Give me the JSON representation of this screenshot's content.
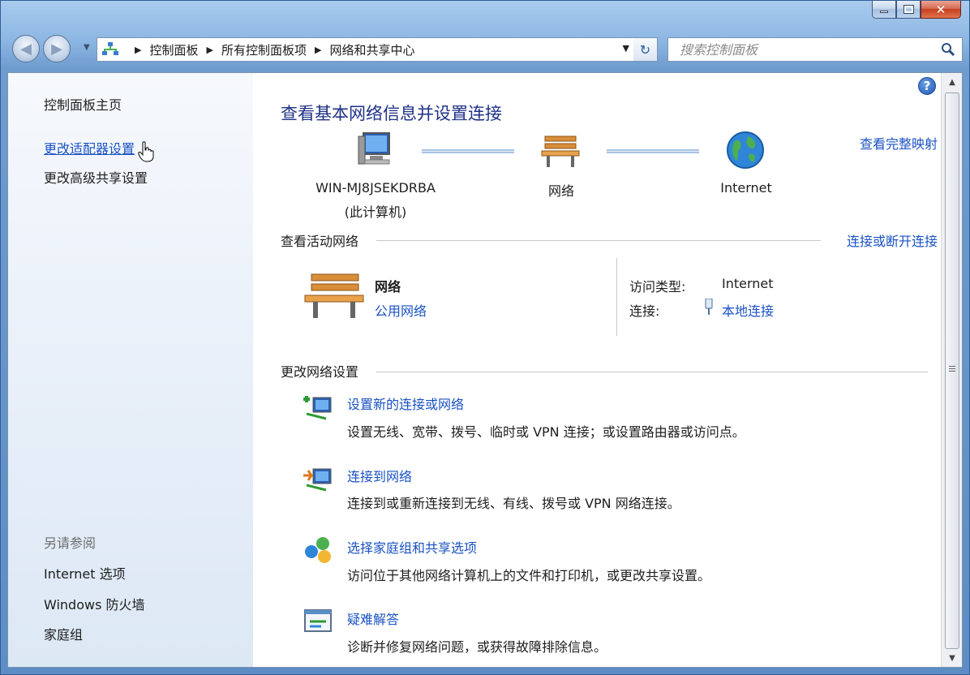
{
  "breadcrumb": [
    "控制面板",
    "所有控制面板项",
    "网络和共享中心"
  ],
  "search": {
    "placeholder": "搜索控制面板"
  },
  "left_pane": {
    "home": "控制面板主页",
    "links": [
      "更改适配器设置",
      "更改高级共享设置"
    ],
    "see_also_title": "另请参阅",
    "see_also": [
      "Internet 选项",
      "Windows 防火墙",
      "家庭组"
    ]
  },
  "main": {
    "title": "查看基本网络信息并设置连接",
    "map_link": "查看完整映射",
    "nodes": {
      "computer": "WIN-MJ8JSEKDRBA",
      "computer_sub": "(此计算机)",
      "network": "网络",
      "internet": "Internet"
    },
    "active_section": {
      "title": "查看活动网络",
      "right_link": "连接或断开连接",
      "network_name": "网络",
      "network_type": "公用网络",
      "access_type_label": "访问类型:",
      "access_type_value": "Internet",
      "connection_label": "连接:",
      "connection_value": "本地连接"
    },
    "change_section": {
      "title": "更改网络设置",
      "tasks": [
        {
          "title": "设置新的连接或网络",
          "desc": "设置无线、宽带、拨号、临时或 VPN 连接；或设置路由器或访问点。"
        },
        {
          "title": "连接到网络",
          "desc": "连接到或重新连接到无线、有线、拨号或 VPN 网络连接。"
        },
        {
          "title": "选择家庭组和共享选项",
          "desc": "访问位于其他网络计算机上的文件和打印机，或更改共享设置。"
        },
        {
          "title": "疑难解答",
          "desc": "诊断并修复网络问题，或获得故障排除信息。"
        }
      ]
    }
  }
}
